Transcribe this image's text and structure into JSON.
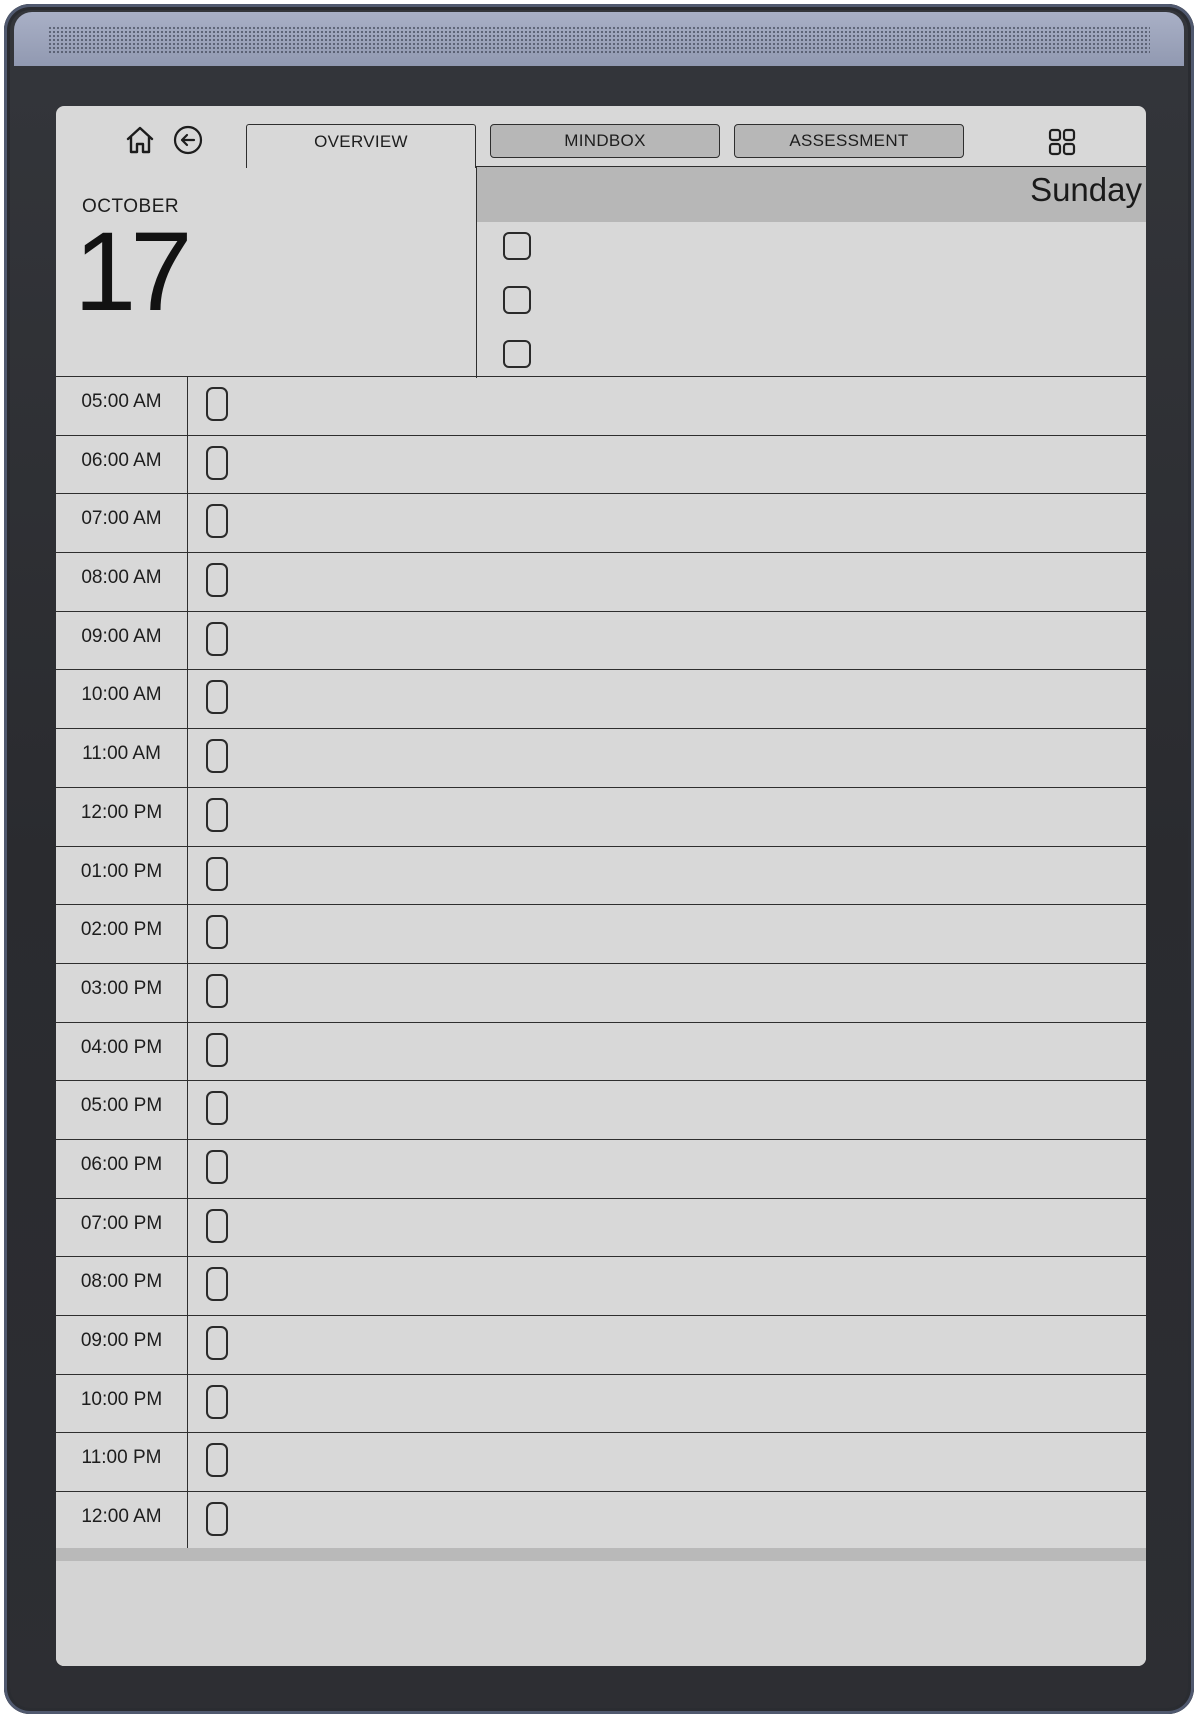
{
  "tabs": {
    "overview": "OVERVIEW",
    "mindbox": "MINDBOX",
    "assessment": "ASSESSMENT"
  },
  "icons": {
    "home": "home-icon",
    "back": "back-arrow-icon",
    "grid": "grid-icon"
  },
  "date": {
    "month": "OCTOBER",
    "day": "17",
    "weekday": "Sunday"
  },
  "tasks": [
    {
      "checked": false
    },
    {
      "checked": false
    },
    {
      "checked": false
    }
  ],
  "hours": [
    "05:00 AM",
    "06:00 AM",
    "07:00 AM",
    "08:00 AM",
    "09:00 AM",
    "10:00 AM",
    "11:00 AM",
    "12:00 PM",
    "01:00 PM",
    "02:00 PM",
    "03:00 PM",
    "04:00 PM",
    "05:00 PM",
    "06:00 PM",
    "07:00 PM",
    "08:00 PM",
    "09:00 PM",
    "10:00 PM",
    "11:00 PM",
    "12:00 AM"
  ],
  "colors": {
    "screen": "#d8d8d8",
    "header_band": "#b7b7b7",
    "ink": "#1d1d1d",
    "bezel": "#2c2d31",
    "speaker_strip": "#9aa1b8"
  }
}
